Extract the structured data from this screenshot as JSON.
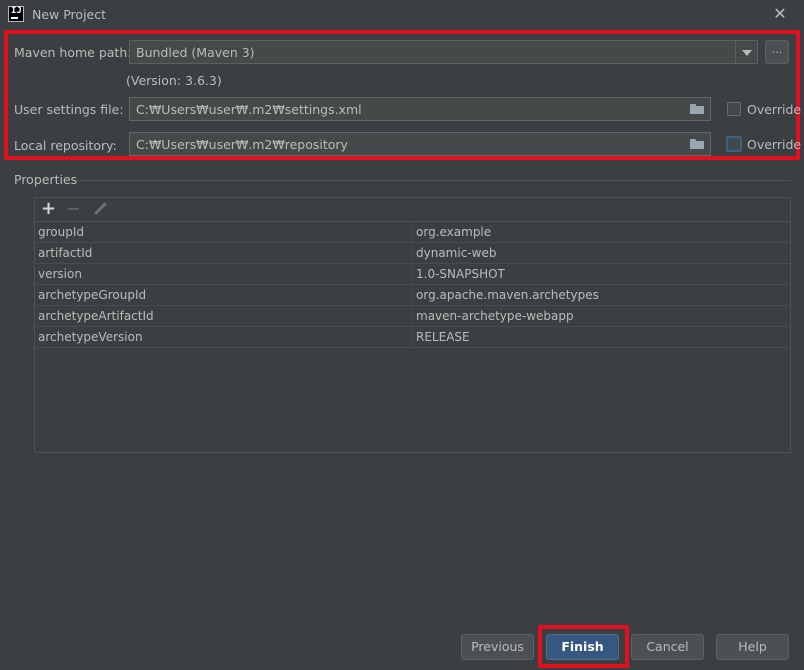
{
  "window": {
    "title": "New Project",
    "app_icon_text": "IJ"
  },
  "maven": {
    "home_label": "Maven home path:",
    "home_value": "Bundled (Maven 3)",
    "browse_label": "...",
    "version_text": "(Version: 3.6.3)",
    "user_settings_label": "User settings file:",
    "user_settings_value": "C:₩Users₩user₩.m2₩settings.xml",
    "local_repo_label": "Local repository:",
    "local_repo_value": "C:₩Users₩user₩.m2₩repository",
    "override_label": "Override"
  },
  "properties": {
    "section_label": "Properties",
    "add_symbol": "+",
    "remove_symbol": "−",
    "rows": [
      {
        "key": "groupId",
        "value": "org.example"
      },
      {
        "key": "artifactId",
        "value": "dynamic-web"
      },
      {
        "key": "version",
        "value": "1.0-SNAPSHOT"
      },
      {
        "key": "archetypeGroupId",
        "value": "org.apache.maven.archetypes"
      },
      {
        "key": "archetypeArtifactId",
        "value": "maven-archetype-webapp"
      },
      {
        "key": "archetypeVersion",
        "value": "RELEASE"
      }
    ]
  },
  "buttons": {
    "previous": "Previous",
    "finish": "Finish",
    "cancel": "Cancel",
    "help": "Help"
  },
  "colors": {
    "background": "#3c3f41",
    "field": "#45494a",
    "highlight": "#e2101e",
    "primary_button": "#365880"
  }
}
